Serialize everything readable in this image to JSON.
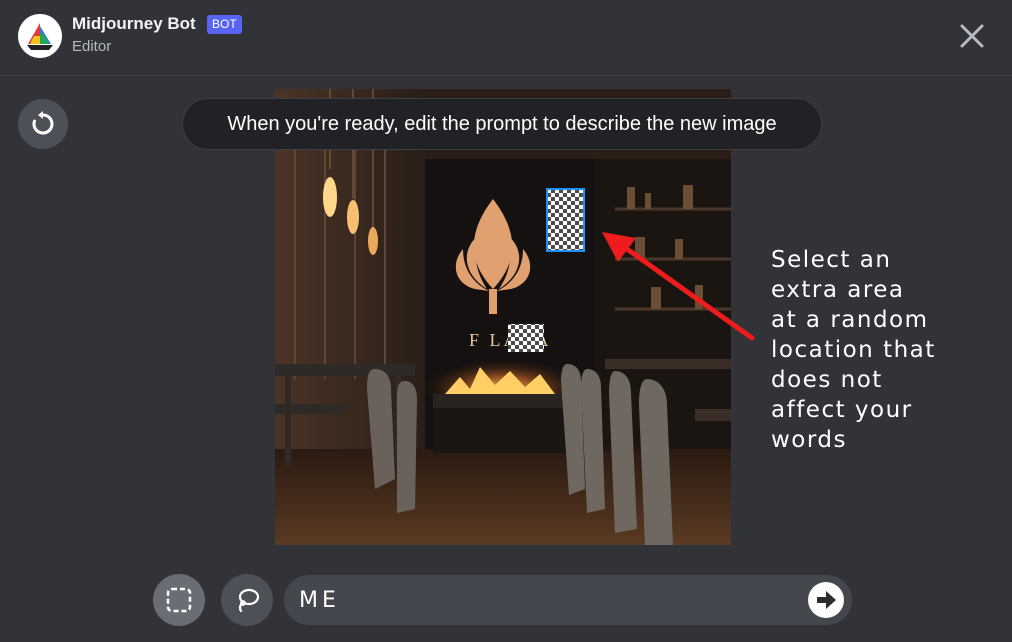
{
  "header": {
    "bot_name": "Midjourney Bot",
    "bot_badge": "BOT",
    "subtitle": "Editor",
    "avatar_icon": "sailboat-logo-icon",
    "close_icon": "close-icon"
  },
  "tooltip": {
    "text": "When you're ready, edit the prompt to describe the new image"
  },
  "canvas": {
    "logo_text": "F LANA",
    "selection_color": "#1e90ff"
  },
  "annotation": {
    "lines": [
      "Select an",
      "extra area",
      "at a random",
      "location that",
      "does not",
      "affect your",
      "words"
    ],
    "arrow_color": "#ee1c1c"
  },
  "toolbar": {
    "select_tool_icon": "rectangle-select-icon",
    "lasso_tool_icon": "lasso-icon",
    "reset_icon": "undo-icon"
  },
  "prompt": {
    "value": "ME",
    "submit_icon": "arrow-right-icon"
  },
  "colors": {
    "background": "#313338",
    "bot_badge": "#5865f2",
    "tool_active": "#6b6d74"
  }
}
